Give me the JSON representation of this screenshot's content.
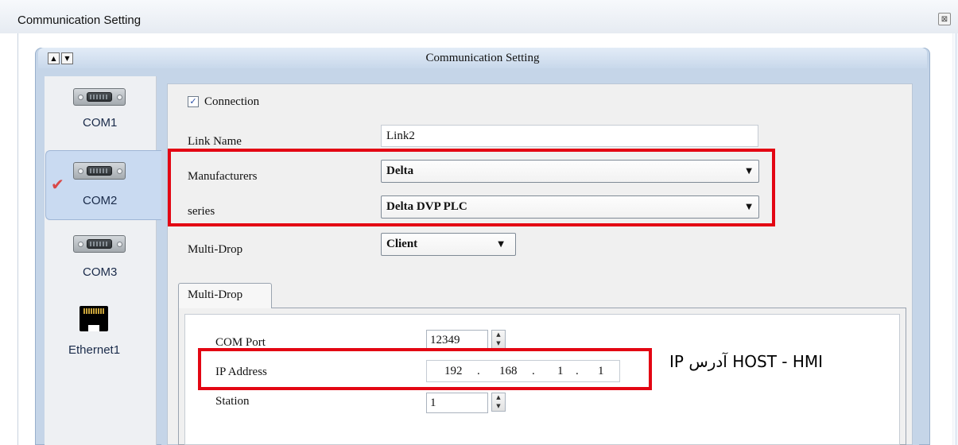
{
  "window": {
    "title": "Communication Setting",
    "close_glyph": "⊠"
  },
  "panel": {
    "title": "Communication Setting",
    "nav_up_glyph": "▲",
    "nav_down_glyph": "▼"
  },
  "sidebar": {
    "items": [
      {
        "label": "COM1",
        "icon": "serial-port-icon",
        "selected": false
      },
      {
        "label": "COM2",
        "icon": "serial-port-icon",
        "selected": true
      },
      {
        "label": "COM3",
        "icon": "serial-port-icon",
        "selected": false
      },
      {
        "label": "Ethernet1",
        "icon": "ethernet-port-icon",
        "selected": false
      }
    ],
    "check_glyph": "✔"
  },
  "form": {
    "connection_label": "Connection",
    "connection_checked": true,
    "check_glyph": "✓",
    "link_name_label": "Link Name",
    "link_name_value": "Link2",
    "manufacturers_label": "Manufacturers",
    "manufacturers_value": "Delta",
    "series_label": "series",
    "series_value": "Delta DVP PLC",
    "multidrop_label": "Multi-Drop",
    "multidrop_value": "Client",
    "dropdown_glyph": "▼"
  },
  "tab": {
    "label": "Multi-Drop"
  },
  "multidrop": {
    "com_port_label": "COM Port",
    "com_port_value": "12349",
    "ip_label": "IP Address",
    "ip_octets": [
      "192",
      "168",
      "1",
      "1"
    ],
    "ip_separator": ".",
    "station_label": "Station",
    "station_value": "1",
    "spin_up_glyph": "▲",
    "spin_down_glyph": "▼"
  },
  "annotation": {
    "text": "IP آدرس HOST - HMI",
    "color": "#e30613"
  }
}
